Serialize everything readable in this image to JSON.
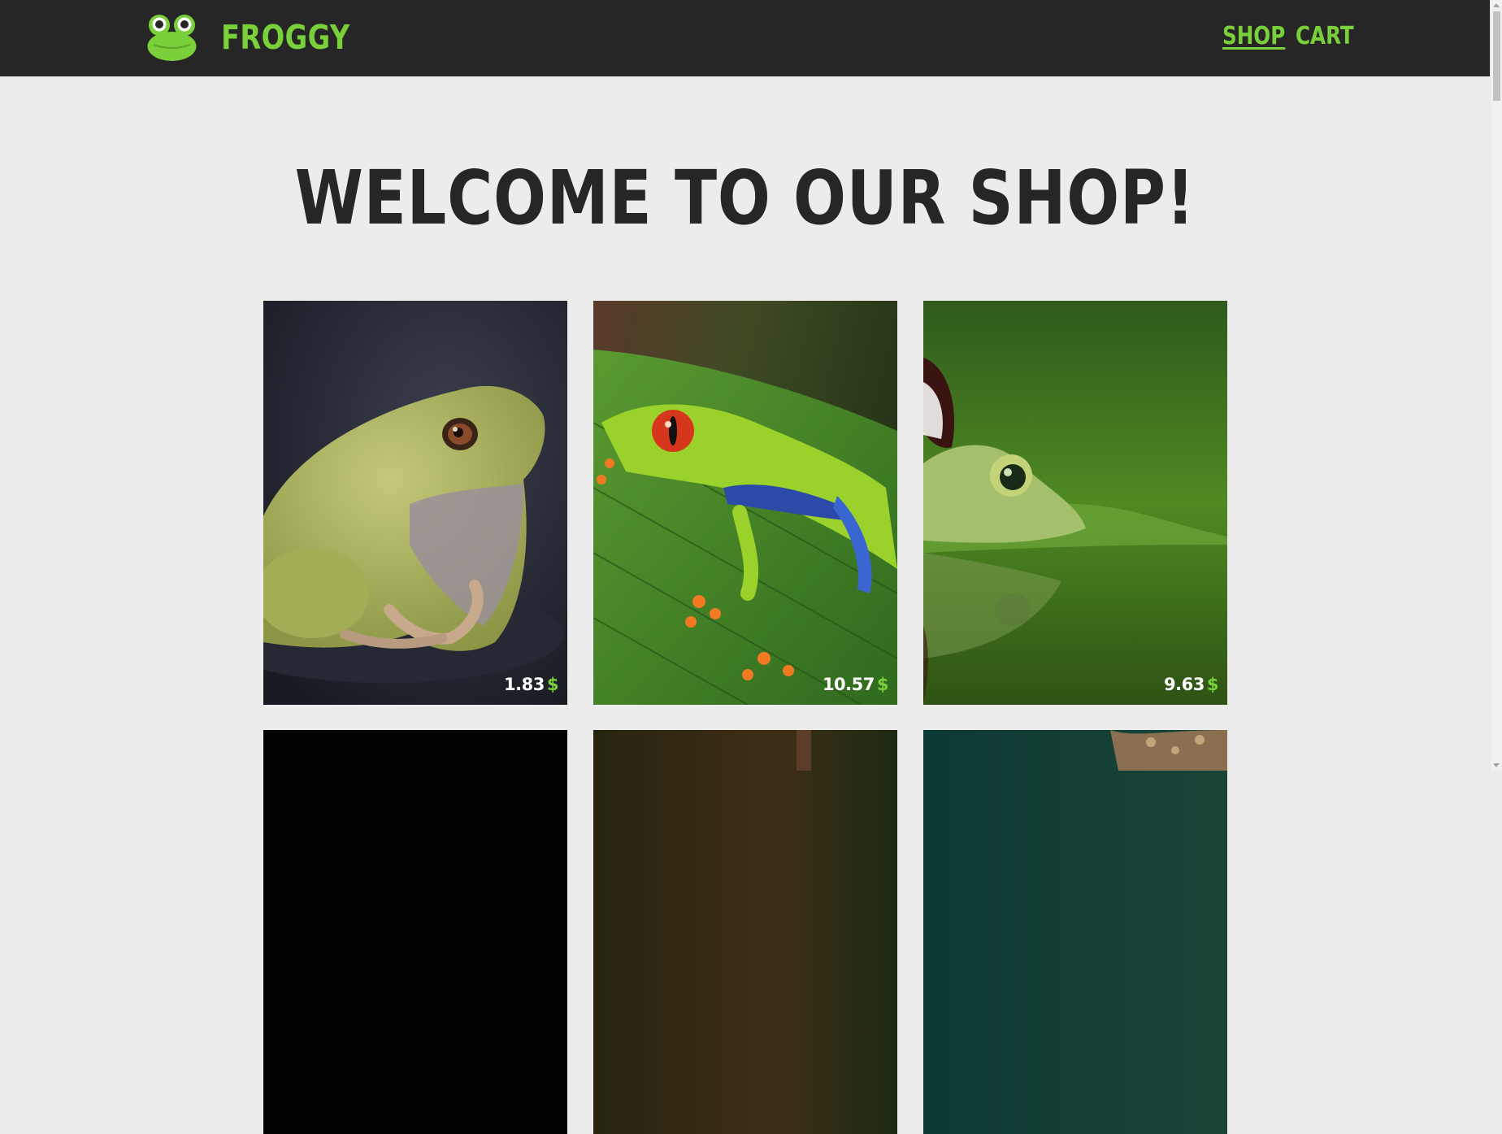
{
  "header": {
    "brand": "FROGGY",
    "logo_icon": "frog-face-icon",
    "nav": [
      {
        "label": "SHOP",
        "active": true
      },
      {
        "label": "CART",
        "active": false
      }
    ]
  },
  "main": {
    "title": "WELCOME TO OUR SHOP!"
  },
  "products": [
    {
      "price": "1.83",
      "currency": "$",
      "image": "green tree frog photo"
    },
    {
      "price": "10.57",
      "currency": "$",
      "image": "red-eyed tree frog photo"
    },
    {
      "price": "9.63",
      "currency": "$",
      "image": "frog with butterfly photo"
    },
    {
      "image": "dark product photo"
    },
    {
      "image": "forest product photo"
    },
    {
      "image": "teal product photo"
    }
  ],
  "colors": {
    "accent": "#79d03a",
    "navbar": "#262626",
    "background": "#ececec",
    "text": "#262626"
  }
}
